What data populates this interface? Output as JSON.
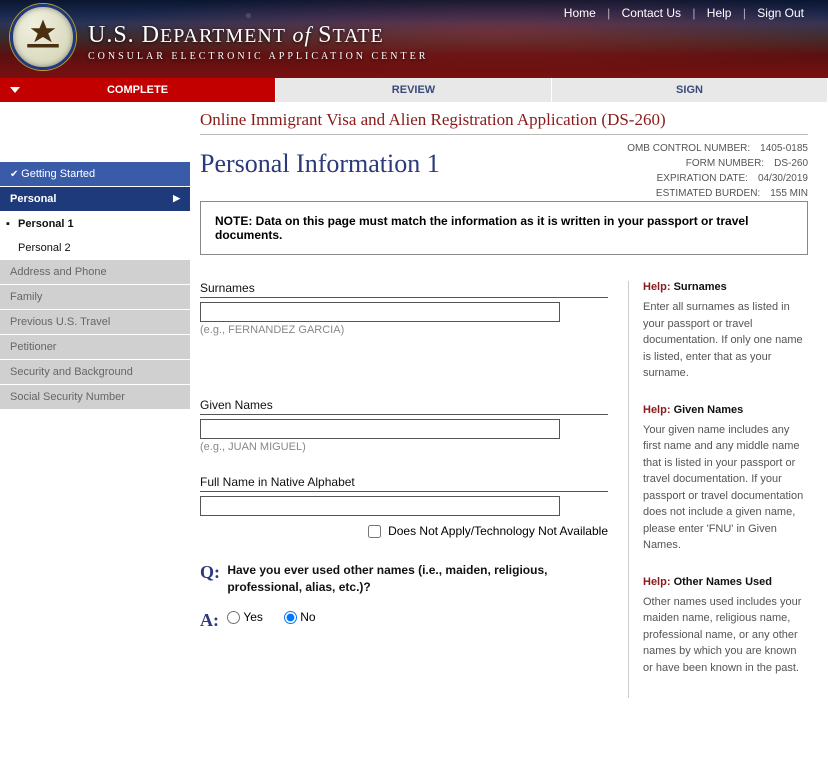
{
  "header": {
    "top_links": [
      "Home",
      "Contact Us",
      "Help",
      "Sign Out"
    ],
    "dept_line1_a": "U.S. D",
    "dept_line1_b": "EPARTMENT",
    "dept_line1_of": " of ",
    "dept_line1_c": "S",
    "dept_line1_d": "TATE",
    "dept_line2": "CONSULAR ELECTRONIC APPLICATION CENTER"
  },
  "tabs": {
    "complete": "COMPLETE",
    "review": "REVIEW",
    "sign": "SIGN"
  },
  "sidebar": {
    "getting_started": "Getting Started",
    "personal": "Personal",
    "personal_1": "Personal 1",
    "personal_2": "Personal 2",
    "address_phone": "Address and Phone",
    "family": "Family",
    "prev_travel": "Previous U.S. Travel",
    "petitioner": "Petitioner",
    "security": "Security and Background",
    "ssn": "Social Security Number"
  },
  "page": {
    "title_red": "Online Immigrant Visa and Alien Registration Application (DS-260)",
    "meta": [
      {
        "lbl": "OMB CONTROL NUMBER:",
        "val": "1405-0185"
      },
      {
        "lbl": "FORM NUMBER:",
        "val": "DS-260"
      },
      {
        "lbl": "EXPIRATION DATE:",
        "val": "04/30/2019"
      },
      {
        "lbl": "ESTIMATED BURDEN:",
        "val": "155 MIN"
      }
    ],
    "section_title": "Personal Information 1",
    "note": "NOTE: Data on this page must match the information as it is written in your passport or travel documents."
  },
  "form": {
    "surnames": {
      "label": "Surnames",
      "value": "",
      "hint": "(e.g., FERNANDEZ GARCIA)"
    },
    "given": {
      "label": "Given Names",
      "value": "",
      "hint": "(e.g., JUAN MIGUEL)"
    },
    "native": {
      "label": "Full Name in Native Alphabet",
      "value": ""
    },
    "native_na": {
      "label": "Does Not Apply/Technology Not Available",
      "checked": false
    },
    "other_names": {
      "question": "Have you ever used other names (i.e., maiden, religious, professional, alias, etc.)?",
      "yes": "Yes",
      "no": "No",
      "answer": "No"
    }
  },
  "help": {
    "surnames": {
      "title": "Surnames",
      "text": "Enter all surnames as listed in your passport or travel documentation. If only one name is listed, enter that as your surname."
    },
    "given": {
      "title": "Given Names",
      "text": "Your given name includes any first name and any middle name that is listed in your passport or travel documentation. If your passport or travel documentation does not include a given name, please enter 'FNU' in Given Names."
    },
    "other": {
      "title": "Other Names Used",
      "text": "Other names used includes your maiden name, religious name, professional name, or any other names by which you are known or have been known in the past."
    },
    "help_word": "Help:"
  }
}
